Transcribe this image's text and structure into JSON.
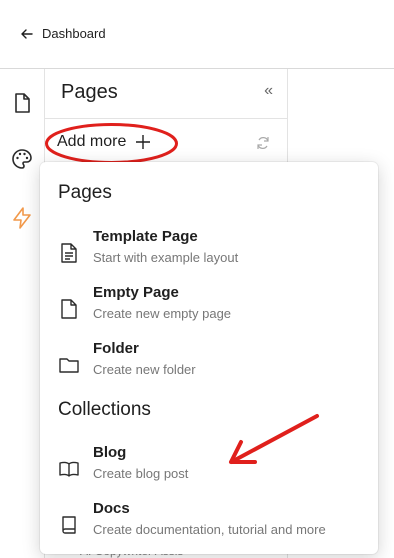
{
  "topbar": {
    "back_label": "Dashboard"
  },
  "rail": {
    "icons": [
      "document-icon",
      "palette-icon",
      "lightning-icon"
    ]
  },
  "panel": {
    "title": "Pages",
    "add_more_label": "Add more",
    "peek_text": "AI Copywriter Assis"
  },
  "menu": {
    "sections": [
      {
        "title": "Pages"
      },
      {
        "title": "Collections"
      }
    ],
    "items": [
      {
        "title": "Template Page",
        "desc": "Start with example layout"
      },
      {
        "title": "Empty Page",
        "desc": "Create new empty page"
      },
      {
        "title": "Folder",
        "desc": "Create new folder"
      },
      {
        "title": "Blog",
        "desc": "Create blog post"
      },
      {
        "title": "Docs",
        "desc": "Create documentation, tutorial and more"
      }
    ]
  },
  "colors": {
    "accent": "#f2994a",
    "annotation": "#e0201c"
  }
}
